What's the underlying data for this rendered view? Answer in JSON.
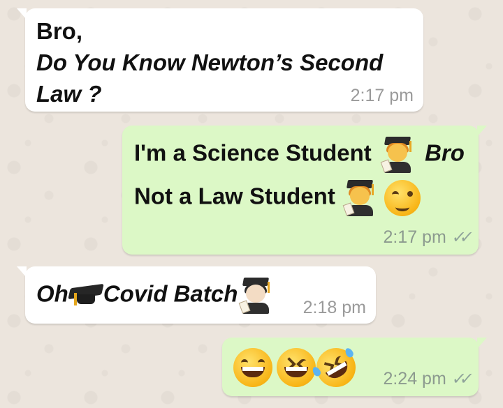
{
  "chat": {
    "messages": [
      {
        "direction": "incoming",
        "line1": "Bro,",
        "line2": "Do You Know Newton’s Second",
        "line3": "Law ?",
        "time": "2:17 pm"
      },
      {
        "direction": "outgoing",
        "line1_text": "I'm a Science Student",
        "line1_emoji": "woman-student-emoji",
        "line1_tail": "Bro",
        "line2_text": "Not a Law Student",
        "line2_emoji1": "woman-student-emoji",
        "line2_emoji2": "winking-face-emoji",
        "time": "2:17 pm",
        "status": "read-double-check"
      },
      {
        "direction": "incoming",
        "word1": "Oh",
        "emoji1": "graduation-cap-emoji",
        "word2": "Covid Batch",
        "emoji2": "student-emoji",
        "time": "2:18 pm"
      },
      {
        "direction": "outgoing",
        "emojis": [
          "grinning-face-emoji",
          "laughing-face-emoji",
          "rolling-on-floor-laughing-emoji"
        ],
        "time": "2:24 pm",
        "status": "read-double-check"
      }
    ]
  },
  "colors": {
    "wallpaper": "#ece5dd",
    "incoming_bubble": "#ffffff",
    "outgoing_bubble": "#dcf8c6",
    "timestamp": "#8c9a8f"
  }
}
